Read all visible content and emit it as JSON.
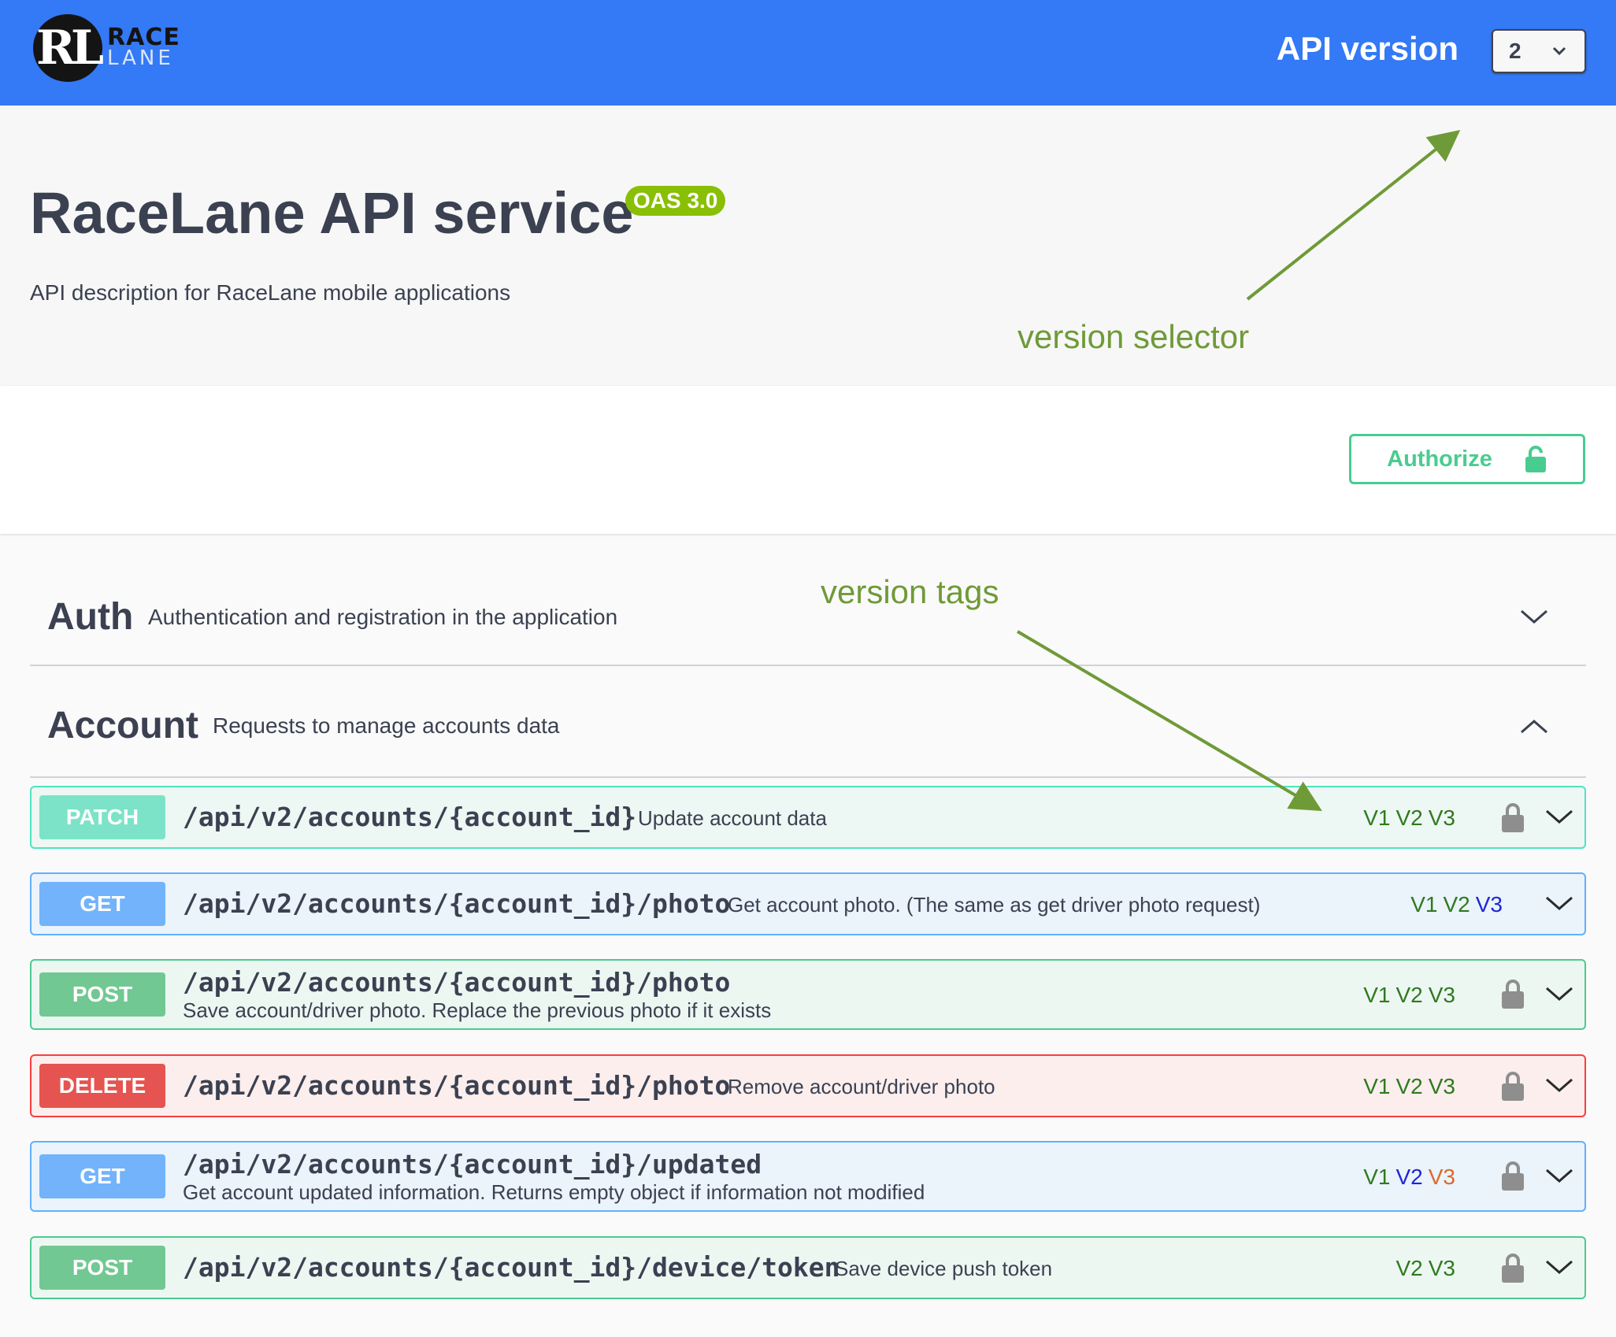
{
  "logo": {
    "line1": "RACE",
    "line2": "LANE",
    "mark": "RL"
  },
  "header": {
    "api_version_label": "API version",
    "selected_version": "2"
  },
  "info": {
    "title": "RaceLane API service",
    "oas_badge": "OAS 3.0",
    "description": "API description for RaceLane mobile applications"
  },
  "authorize": {
    "label": "Authorize"
  },
  "annotations": {
    "version_selector": "version selector",
    "version_tags": "version tags"
  },
  "tags": [
    {
      "name": "Auth",
      "description": "Authentication and registration in the application",
      "expanded": false
    },
    {
      "name": "Account",
      "description": "Requests to manage accounts data",
      "expanded": true
    }
  ],
  "operations": [
    {
      "method": "PATCH",
      "path": "/api/v2/accounts/{account_id}",
      "summary": "Update account data",
      "versions": [
        {
          "label": "V1",
          "color": "#2f7a1f"
        },
        {
          "label": "V2",
          "color": "#2f7a1f"
        },
        {
          "label": "V3",
          "color": "#2f7a1f"
        }
      ],
      "locked": true
    },
    {
      "method": "GET",
      "path": "/api/v2/accounts/{account_id}/photo",
      "summary": "Get account photo. (The same as get driver photo request)",
      "versions": [
        {
          "label": "V1",
          "color": "#2f7a1f"
        },
        {
          "label": "V2",
          "color": "#2f7a1f"
        },
        {
          "label": "V3",
          "color": "#1f27d8"
        }
      ],
      "locked": false
    },
    {
      "method": "POST",
      "path": "/api/v2/accounts/{account_id}/photo",
      "summary": "Save account/driver photo. Replace the previous photo if it exists",
      "versions": [
        {
          "label": "V1",
          "color": "#2f7a1f"
        },
        {
          "label": "V2",
          "color": "#2f7a1f"
        },
        {
          "label": "V3",
          "color": "#2f7a1f"
        }
      ],
      "locked": true
    },
    {
      "method": "DELETE",
      "path": "/api/v2/accounts/{account_id}/photo",
      "summary": "Remove account/driver photo",
      "versions": [
        {
          "label": "V1",
          "color": "#2f7a1f"
        },
        {
          "label": "V2",
          "color": "#2f7a1f"
        },
        {
          "label": "V3",
          "color": "#2f7a1f"
        }
      ],
      "locked": true
    },
    {
      "method": "GET",
      "path": "/api/v2/accounts/{account_id}/updated",
      "summary": "Get account updated information. Returns empty object if information not modified",
      "versions": [
        {
          "label": "V1",
          "color": "#2f7a1f"
        },
        {
          "label": "V2",
          "color": "#1f27d8"
        },
        {
          "label": "V3",
          "color": "#d86a2c"
        }
      ],
      "locked": true
    },
    {
      "method": "POST",
      "path": "/api/v2/accounts/{account_id}/device/token",
      "summary": "Save device push token",
      "versions": [
        {
          "label": "V2",
          "color": "#2f7a1f"
        },
        {
          "label": "V3",
          "color": "#2f7a1f"
        }
      ],
      "locked": true
    }
  ],
  "icons": {
    "lock": "lock-icon",
    "chevron_down": "chevron-down-icon",
    "chevron_up": "chevron-up-icon",
    "unlock": "unlock-icon"
  }
}
